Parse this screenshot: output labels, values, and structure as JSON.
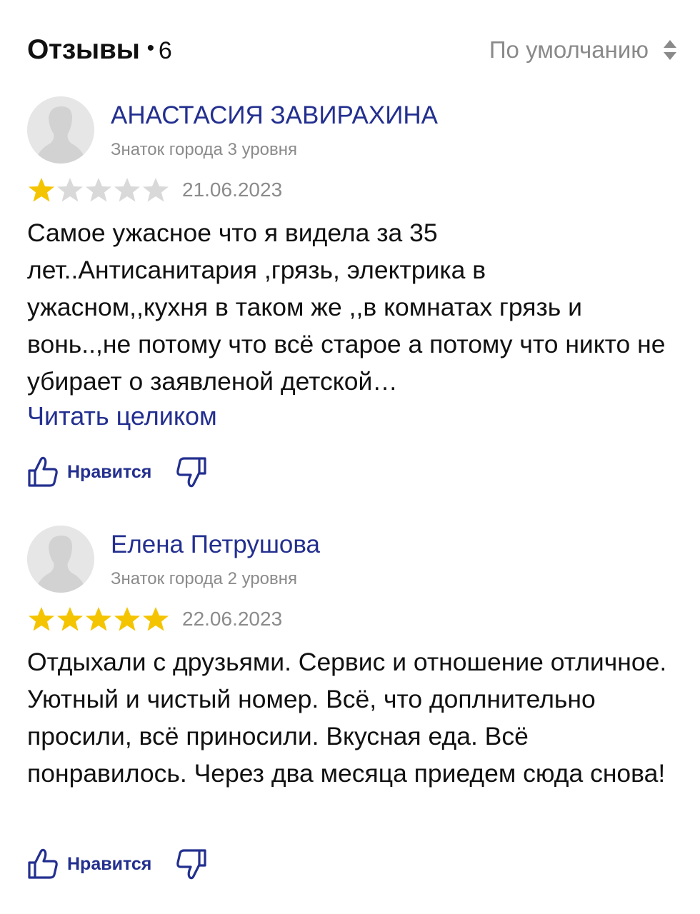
{
  "header": {
    "title": "Отзывы",
    "separator": "•",
    "count": "6",
    "sort_label": "По умолчанию"
  },
  "colors": {
    "link": "#232f8f",
    "star_filled": "#f5c400",
    "star_empty": "#d9d9d9",
    "muted": "#8b8b8b"
  },
  "reviews": [
    {
      "author": "АНАСТАСИЯ ЗАВИРАХИНА",
      "level": "Знаток города 3 уровня",
      "rating": 1,
      "date": "21.06.2023",
      "text": "Самое ужасное что я видела за 35 лет..Антисанитария ,грязь, электрика в ужасном,,кухня в таком же ,,в комнатах грязь и вонь..,не потому что всё старое а потому что никто не убирает о заявленой детской…",
      "read_more": "Читать целиком",
      "like_label": "Нравится"
    },
    {
      "author": "Елена Петрушова",
      "level": "Знаток города 2 уровня",
      "rating": 5,
      "date": "22.06.2023",
      "text": "Отдыхали с друзьями. Сервис и отношение отличное. Уютный и чистый номер. Всё, что доплнительно просили, всё приносили. Вкусная еда. Всё понравилось. Через два месяца приедем сюда снова!",
      "like_label": "Нравится"
    }
  ]
}
